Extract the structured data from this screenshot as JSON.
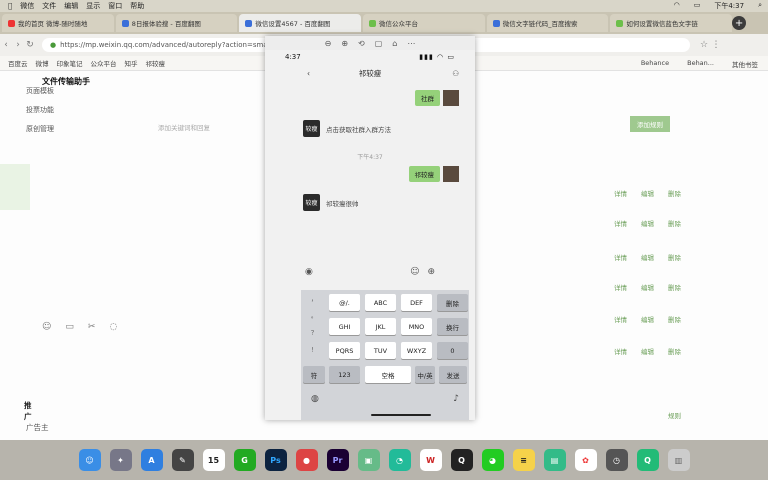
{
  "menubar": {
    "items": [
      "微信",
      "文件",
      "编辑",
      "显示",
      "窗口",
      "帮助"
    ],
    "clock": "下午4:37"
  },
  "tabs": [
    {
      "label": "我的首页 微博-随时随地"
    },
    {
      "label": "8日报体验搜 - 百度翻图"
    },
    {
      "label": "微信设置4567 - 百度翻图"
    },
    {
      "label": "微信公众平台"
    },
    {
      "label": "微信文字链代码_百度搜索"
    },
    {
      "label": "如何设置微信蓝色文字链"
    }
  ],
  "urlbar": {
    "url": "https://mp.weixin.qq.com/advanced/autoreply?action=smart"
  },
  "bookmarks": {
    "items": [
      "百度云",
      "微博",
      "印象笔记",
      "公众平台",
      "知乎",
      "祁较瘦"
    ],
    "right": [
      "Behance",
      "Behan...",
      "其他书签"
    ]
  },
  "left": {
    "nav": [
      "页面模板",
      "投票功能",
      "原创管理"
    ],
    "chat_title": "文件传输助手",
    "bottom_section": "推广",
    "bottom_item": "广告主",
    "faint_hint": "添加关键词和回复"
  },
  "right": {
    "button": "添加规则",
    "row_a": [
      "详情",
      "编辑",
      "删除"
    ],
    "footer": "规则"
  },
  "phone": {
    "clock": "4:37",
    "chat_name": "祁较瘦",
    "messages": [
      {
        "side": "right",
        "text": "社群"
      },
      {
        "side": "left",
        "avatar": "较瘦",
        "text": "点击获取社群入群方法"
      },
      {
        "side": "time",
        "text": "下午4:37"
      },
      {
        "side": "right",
        "text": "祁较瘦"
      },
      {
        "side": "left",
        "avatar": "较瘦",
        "text": "祁较瘦很帅"
      }
    ],
    "keyboard": {
      "left_col": [
        "，",
        "。",
        "？",
        "！"
      ],
      "rows": [
        [
          "@/.",
          "ABC",
          "DEF"
        ],
        [
          "GHI",
          "JKL",
          "MNO"
        ],
        [
          "PQRS",
          "TUV",
          "WXYZ"
        ]
      ],
      "right_keys": [
        "删除",
        "换行",
        "0"
      ],
      "bottom": [
        "符",
        "123",
        "空格",
        "中/英",
        "发送"
      ]
    }
  },
  "dock": {
    "items": [
      "Finder",
      "Launchpad",
      "Safari",
      "Compass",
      "Calendar 15",
      "G",
      "Ps",
      "Chrome",
      "Pr",
      "Preview",
      "Pinwheel",
      "WPS",
      "QQ",
      "WeChat",
      "Notes",
      "Books",
      "Photos",
      "Time",
      "Drop",
      "Trash"
    ]
  }
}
